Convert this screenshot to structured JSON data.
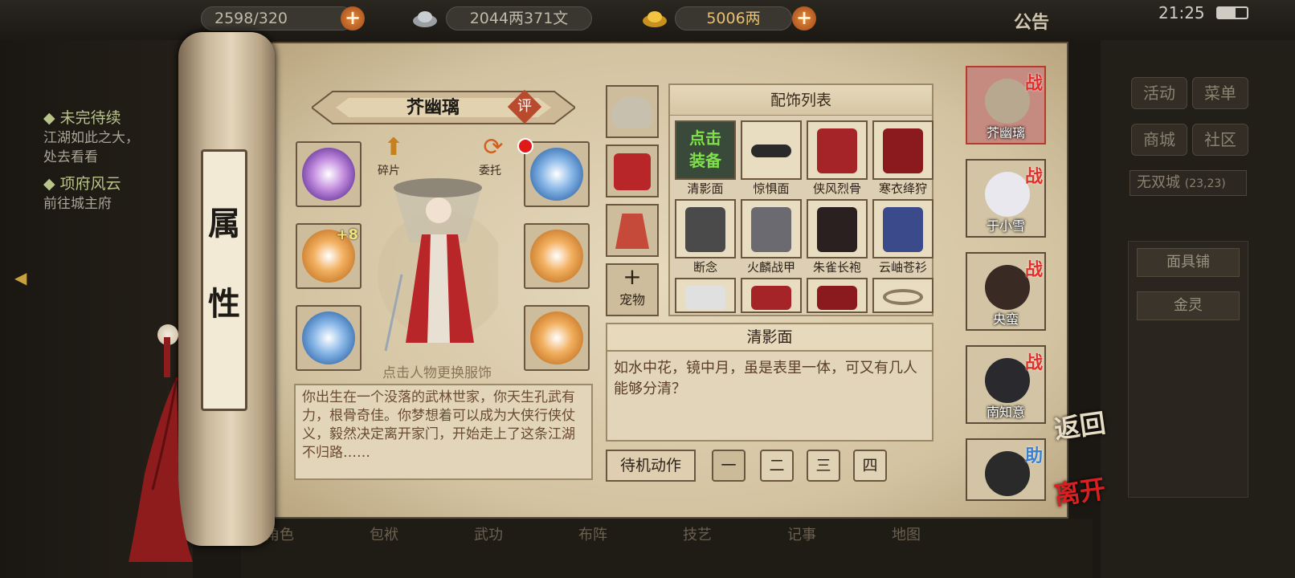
{
  "topbar": {
    "stamina": "2598/320",
    "silver": "2044两371文",
    "gold": "5006两",
    "announce": "公告",
    "time": "21:25"
  },
  "quests": [
    {
      "title": "未完待续",
      "desc": "江湖如此之大，\n处去看看"
    },
    {
      "title": "项府风云",
      "desc": "前往城主府"
    }
  ],
  "right_menu": {
    "activity": "活动",
    "menu": "菜单",
    "shop": "商城",
    "community": "社区",
    "location": "无双城",
    "coords": "(23,23)",
    "npcs": [
      "面具铺",
      "金灵"
    ]
  },
  "scroll_label": "属性",
  "character": {
    "name": "芥幽璃",
    "eval": "评",
    "fragments": "碎片",
    "commission": "委托",
    "plus_level": "+8",
    "hint": "点击人物更换服饰",
    "bio": "你出生在一个没落的武林世家，你天生孔武有力，根骨奇佳。你梦想着可以成为大侠行侠仗义，毅然决定离开家门，开始走上了这条江湖不归路……"
  },
  "pet_label": "宠物",
  "accessories": {
    "header": "配饰列表",
    "equip_hint": "点击\n装备",
    "items": [
      "清影面",
      "惊惧面",
      "侠风烈骨",
      "寒衣绛狩",
      "断念",
      "火麟战甲",
      "朱雀长袍",
      "云岫苍衫",
      "",
      "",
      "",
      ""
    ]
  },
  "selected": {
    "title": "清影面",
    "desc": "如水中花，镜中月，虽是表里一体，可又有几人能够分清？"
  },
  "idle": {
    "label": "待机动作",
    "options": [
      "一",
      "二",
      "三",
      "四"
    ]
  },
  "party": [
    {
      "name": "芥幽璃",
      "tag": "战"
    },
    {
      "name": "于小雪",
      "tag": "战"
    },
    {
      "name": "央蛮",
      "tag": "战"
    },
    {
      "name": "南知意",
      "tag": "战"
    },
    {
      "name": "",
      "tag": "助"
    }
  ],
  "actions": {
    "back": "返回",
    "leave": "离开"
  },
  "bottom_nav": [
    "角色",
    "包袱",
    "武功",
    "布阵",
    "技艺",
    "记事",
    "地图"
  ],
  "colors": {
    "paper": "#dccfb3",
    "accent_red": "#e0302a",
    "dark_bg": "#1b1712"
  }
}
